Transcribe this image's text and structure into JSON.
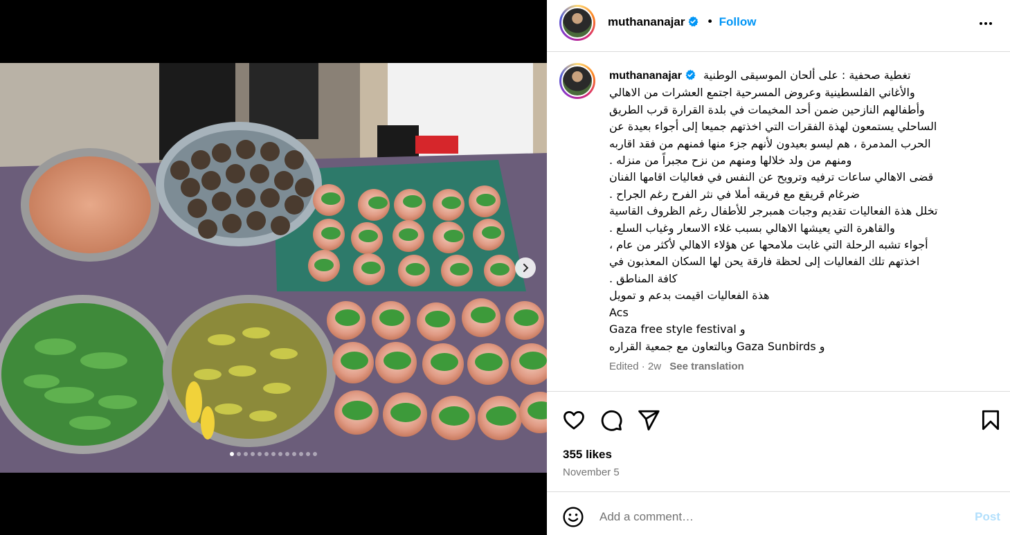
{
  "post": {
    "username": "muthananajar",
    "follow_label": "Follow",
    "separator": "•",
    "image_alt": "Tables of food: burger patties, bread rounds with leaves, pickles, greens and sauce"
  },
  "caption": {
    "username": "muthananajar",
    "lines": [
      "تغطية صحفية : على ألحان الموسيقى الوطنية",
      "والأغاني الفلسطينية وعروض المسرحية اجتمع العشرات من الاهالي",
      "وأطفالهم النازحين ضمن أحد المخيمات في بلدة القرارة قرب الطريق",
      "الساحلي يستمعون لهذة الفقرات التي اخذتهم جميعا إلى أجواء بعيدة عن",
      "الحرب المدمرة ، هم ليسو بعيدون لأنهم جزء منها فمنهم من فقد اقاربه",
      "ومنهم من ولد خلالها ومنهم من نزح مجبراً من منزله .",
      "قضى الاهالي ساعات ترفيه وترويح عن النفس في فعاليات اقامها الفنان",
      "ضرغام قريقع مع فريقه أملا في نثر الفرح رغم الجراح .",
      "تخلل هذة الفعاليات تقديم وجبات همبرجر للأطفال رغم الظروف القاسية",
      "والقاهرة التي يعيشها الاهالي بسبب غلاء الاسعار وغياب السلع .",
      "أجواء تشبه الرحلة التي غابت ملامحها عن هؤلاء الاهالي لأكثر من عام ،",
      "اخذتهم تلك الفعاليات إلى لحظة فارقة يحن لها السكان المعذبون في",
      "كافة المناطق .",
      "هذة الفعاليات اقيمت بدعم و تمويل",
      "Acs",
      "و Gaza free style festival",
      "و Gaza Sunbirds وبالتعاون مع جمعية القراره"
    ],
    "edited": "Edited",
    "age": "2w",
    "see_translation": "See translation"
  },
  "engagement": {
    "likes": "355 likes",
    "date": "November 5"
  },
  "comment": {
    "placeholder": "Add a comment…",
    "post_label": "Post"
  },
  "icons": {
    "like": "heart-icon",
    "comment": "comment-bubble-icon",
    "share": "paper-plane-icon",
    "save": "bookmark-icon",
    "emoji": "emoji-icon",
    "next": "chevron-right-icon",
    "more": "more-options-icon",
    "verified": "verified-badge-icon"
  },
  "colors": {
    "link_blue": "#0095f6",
    "post_disabled": "#b2dffc",
    "muted": "#737373",
    "border": "#dbdbdb"
  },
  "carousel": {
    "total_slides": 13,
    "active_slide": 1
  }
}
